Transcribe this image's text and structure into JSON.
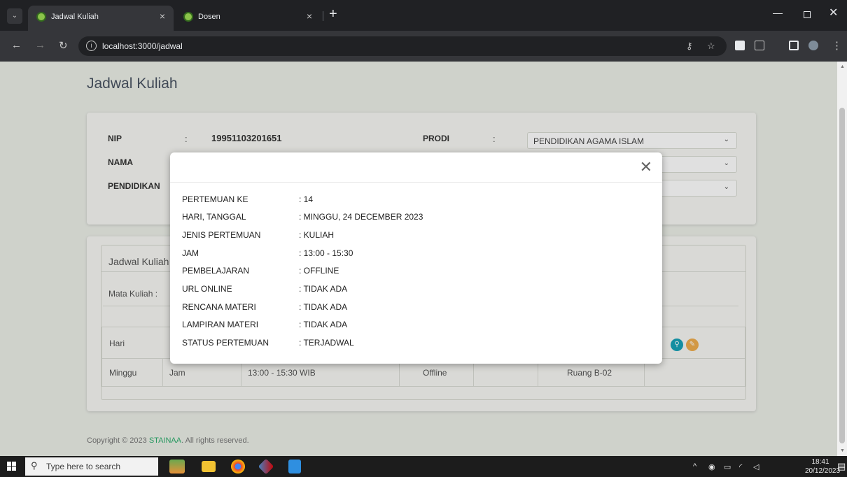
{
  "browser": {
    "tabs": [
      {
        "title": "Jadwal Kuliah",
        "active": true
      },
      {
        "title": "Dosen",
        "active": false
      }
    ],
    "url": "localhost:3000/jadwal"
  },
  "page": {
    "title": "Jadwal Kuliah",
    "info": {
      "nip_label": "NIP",
      "nip_value": "19951103201651",
      "nama_label": "NAMA",
      "pendidikan_label": "PENDIDIKAN",
      "prodi_label": "PRODI",
      "prodi_value": "PENDIDIKAN AGAMA ISLAM",
      "colon": ":"
    },
    "schedule": {
      "header": "Jadwal Kuliah",
      "mata_kuliah_label": "Mata Kuliah :",
      "table": {
        "header_hari": "Hari",
        "row": {
          "hari": "Minggu",
          "label": "Jam",
          "jam": "13:00 - 15:30 WIB",
          "mode": "Offline",
          "ruang": "Ruang B-02"
        }
      }
    },
    "footer": {
      "prefix": "Copyright © 2023 ",
      "brand": "STAINAA",
      "suffix": ". All rights reserved."
    }
  },
  "modal": {
    "details": [
      {
        "label": "PERTEMUAN KE",
        "value": ": 14"
      },
      {
        "label": "HARI, TANGGAL",
        "value": ": MINGGU, 24 DECEMBER 2023"
      },
      {
        "label": "JENIS PERTEMUAN",
        "value": ": KULIAH"
      },
      {
        "label": "JAM",
        "value": ": 13:00 - 15:30"
      },
      {
        "label": "PEMBELAJARAN",
        "value": ": OFFLINE"
      },
      {
        "label": "URL ONLINE",
        "value": ": TIDAK ADA"
      },
      {
        "label": "RENCANA MATERI",
        "value": ": TIDAK ADA"
      },
      {
        "label": "LAMPIRAN MATERI",
        "value": ": TIDAK ADA"
      },
      {
        "label": "STATUS PERTEMUAN",
        "value": ": TERJADWAL"
      }
    ]
  },
  "taskbar": {
    "search_placeholder": "Type here to search",
    "time": "18:41",
    "date": "20/12/2023"
  },
  "colors": {
    "accent_green": "#2eae6e",
    "search_btn": "#17a2b8",
    "edit_btn": "#f0ad4e"
  }
}
